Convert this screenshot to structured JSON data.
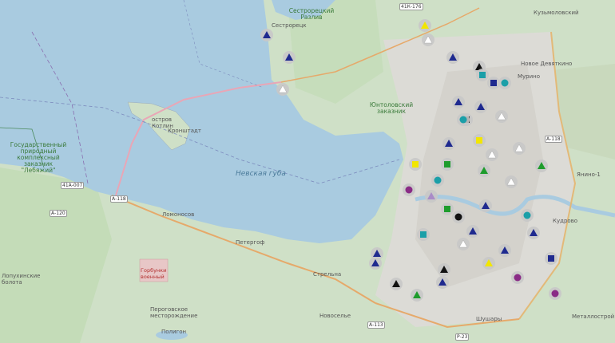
{
  "map": {
    "water_label": "Невская губа",
    "labels": {
      "reserve": [
        "Государственный",
        "природный",
        "комплексный",
        "заказник",
        "\"Лебяжий\""
      ],
      "island": [
        "остров",
        "Котлин"
      ],
      "kronstadt": "Кронштадт",
      "sestroretsk": "Сестрорецк",
      "lomonosov": "Ломоносов",
      "petergof": "Петергоф",
      "strelna": "Стрельна",
      "novoselye": "Новоселье",
      "shushary": "Шушары",
      "murino": "Мурино",
      "kudrovo": "Кудрово",
      "yanino": "Янино-1",
      "novoe_devyatkino": "Новое Девяткино",
      "kuzmolovsky": "Кузьмоловский",
      "metallostroy": "Металлострой",
      "left_edge": "Лопухинские болота",
      "lake_label": "Сестрорецкий Разлив",
      "park_label": "Юнтоловский заказник",
      "military": "Горбунки военный",
      "peterhof_label": "Пероговское месторождение",
      "north_bottom": "Полигон"
    },
    "roads": [
      "А-118",
      "А-120",
      "41А-007",
      "41К-176",
      "Р-23",
      "А-113",
      "А-118"
    ],
    "colors": {
      "water": "#a9cbe0",
      "land": "#cfe0c7",
      "city": "#dcdbd6",
      "marker_circle": "#c8c8c8",
      "navy": "#1f2a8f",
      "green": "#1e9c2c",
      "cyan": "#1b9fa8",
      "purple": "#8a2b86",
      "black": "#111111",
      "yellow": "#f2e600",
      "lavender": "#a98bc7"
    }
  },
  "markers": [
    {
      "shape": "triangle",
      "color": "navy"
    },
    {
      "shape": "triangle",
      "color": "navy"
    },
    {
      "shape": "triangle",
      "color": "white"
    },
    {
      "shape": "triangle",
      "color": "yellow"
    },
    {
      "shape": "triangle",
      "color": "white"
    },
    {
      "shape": "triangle",
      "color": "navy"
    },
    {
      "shape": "triangle",
      "color": "black"
    },
    {
      "shape": "square",
      "color": "cyan"
    },
    {
      "shape": "square",
      "color": "navy"
    },
    {
      "shape": "circle",
      "color": "cyan"
    },
    {
      "shape": "triangle",
      "color": "navy"
    },
    {
      "shape": "triangle",
      "color": "navy"
    },
    {
      "shape": "square",
      "color": "black"
    },
    {
      "shape": "triangle",
      "color": "white"
    },
    {
      "shape": "circle",
      "color": "cyan"
    },
    {
      "shape": "triangle",
      "color": "navy"
    },
    {
      "shape": "square",
      "color": "yellow"
    },
    {
      "shape": "triangle",
      "color": "green"
    },
    {
      "shape": "triangle",
      "color": "white"
    },
    {
      "shape": "circle",
      "color": "cyan"
    },
    {
      "shape": "triangle",
      "color": "white"
    },
    {
      "shape": "square",
      "color": "green"
    },
    {
      "shape": "triangle",
      "color": "green"
    },
    {
      "shape": "circle",
      "color": "purple"
    },
    {
      "shape": "triangle",
      "color": "lavender"
    },
    {
      "shape": "square",
      "color": "green"
    },
    {
      "shape": "circle",
      "color": "black"
    },
    {
      "shape": "square",
      "color": "yellow"
    },
    {
      "shape": "circle",
      "color": "purple"
    },
    {
      "shape": "triangle",
      "color": "navy"
    },
    {
      "shape": "triangle",
      "color": "black"
    },
    {
      "shape": "triangle",
      "color": "navy"
    },
    {
      "shape": "circle",
      "color": "purple"
    },
    {
      "shape": "triangle",
      "color": "navy"
    },
    {
      "shape": "triangle",
      "color": "green"
    },
    {
      "shape": "triangle",
      "color": "navy"
    }
  ]
}
